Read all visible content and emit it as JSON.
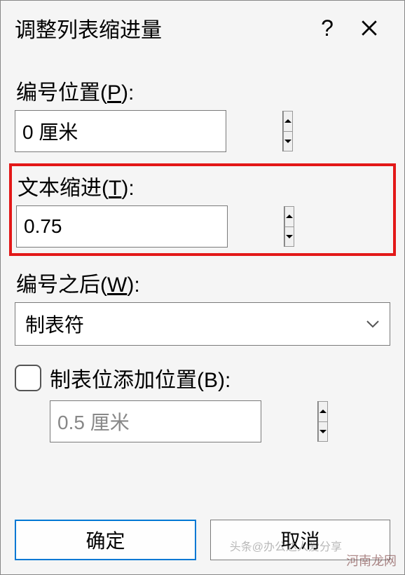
{
  "dialog": {
    "title": "调整列表缩进量",
    "help_symbol": "?",
    "fields": {
      "number_position": {
        "label_prefix": "编号位置(",
        "accelerator": "P",
        "label_suffix": "):",
        "value": "0 厘米"
      },
      "text_indent": {
        "label_prefix": "文本缩进(",
        "accelerator": "T",
        "label_suffix": "):",
        "value": "0.75"
      },
      "after_number": {
        "label_prefix": "编号之后(",
        "accelerator": "W",
        "label_suffix": "):",
        "value": "制表符"
      },
      "tab_position": {
        "label_prefix": "制表位添加位置(",
        "accelerator": "B",
        "label_suffix": "):",
        "value": "0.5 厘米",
        "checked": false
      }
    },
    "buttons": {
      "ok": "确定",
      "cancel": "取消"
    }
  },
  "watermark": "河南龙网",
  "watermark2": "头条@办公达人爱分享"
}
